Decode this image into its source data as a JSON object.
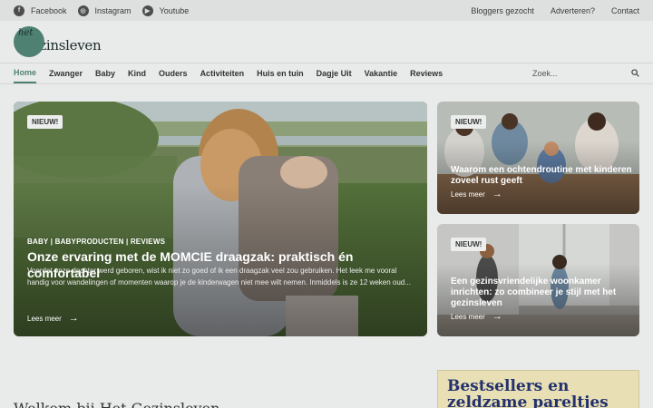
{
  "topbar": {
    "socials": [
      {
        "icon": "facebook-icon",
        "glyph": "f",
        "label": "Facebook"
      },
      {
        "icon": "instagram-icon",
        "glyph": "◎",
        "label": "Instagram"
      },
      {
        "icon": "youtube-icon",
        "glyph": "▶",
        "label": "Youtube"
      }
    ],
    "links": [
      "Bloggers gezocht",
      "Adverteren?",
      "Contact"
    ]
  },
  "header": {
    "logo_small": "het",
    "logo_text": "Gezinsleven"
  },
  "nav": {
    "items": [
      "Home",
      "Zwanger",
      "Baby",
      "Kind",
      "Ouders",
      "Activiteiten",
      "Huis en tuin",
      "Dagje Uit",
      "Vakantie",
      "Reviews"
    ],
    "search_placeholder": "Zoek..."
  },
  "featured": {
    "badge": "NIEUW!",
    "meta": "BABY | BABYPRODUCTEN | REVIEWS",
    "title": "Onze ervaring met de MOMCIE draagzak: praktisch én comfortabel",
    "excerpt": "Voordat onze dochter werd geboren, wist ik niet zo goed of ik een draagzak veel zou gebruiken. Het leek me vooral handig voor wandelingen of momenten waarop je de kinderwagen niet mee wilt nemen. Inmiddels is ze 12 weken oud...",
    "more": "Lees meer"
  },
  "side_articles": [
    {
      "badge": "NIEUW!",
      "title": "Waarom een ochtendroutine met kinderen zoveel rust geeft",
      "more": "Lees meer"
    },
    {
      "badge": "NIEUW!",
      "title": "Een gezinsvriendelijke woonkamer inrichten: zo combineer je stijl met het gezinsleven",
      "more": "Lees meer"
    }
  ],
  "welcome": "Welkom bij Het Gezinsleven",
  "promo": {
    "text": "Bestsellers en zeldzame pareltjes"
  },
  "colors": {
    "accent": "#4f8173",
    "promo_text": "#23316e",
    "promo_bg": "#e8e0b4"
  }
}
